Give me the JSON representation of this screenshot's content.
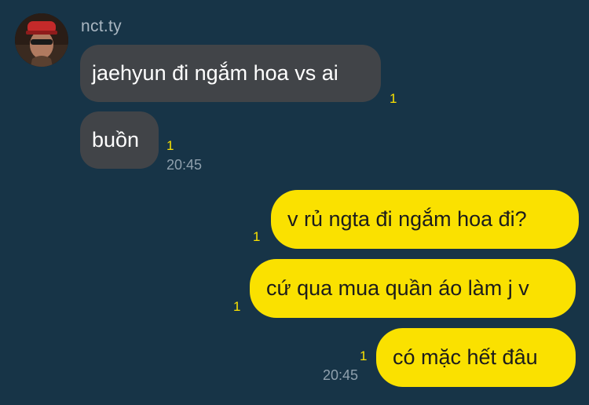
{
  "chat": {
    "sender_name": "nct.ty",
    "incoming": [
      {
        "text": "jaehyun đi ngắm hoa vs ai",
        "unread": "1",
        "time": ""
      },
      {
        "text": "buồn",
        "unread": "1",
        "time": "20:45"
      }
    ],
    "outgoing": [
      {
        "text": "v rủ ngta đi ngắm hoa đi?",
        "unread": "1",
        "time": ""
      },
      {
        "text": "cứ qua mua quần áo làm j v",
        "unread": "1",
        "time": ""
      },
      {
        "text": "có mặc hết đâu",
        "unread": "1",
        "time": "20:45"
      }
    ]
  },
  "colors": {
    "background": "#173447",
    "incoming_bubble": "#414448",
    "outgoing_bubble": "#fae100",
    "unread_count": "#fae100"
  }
}
